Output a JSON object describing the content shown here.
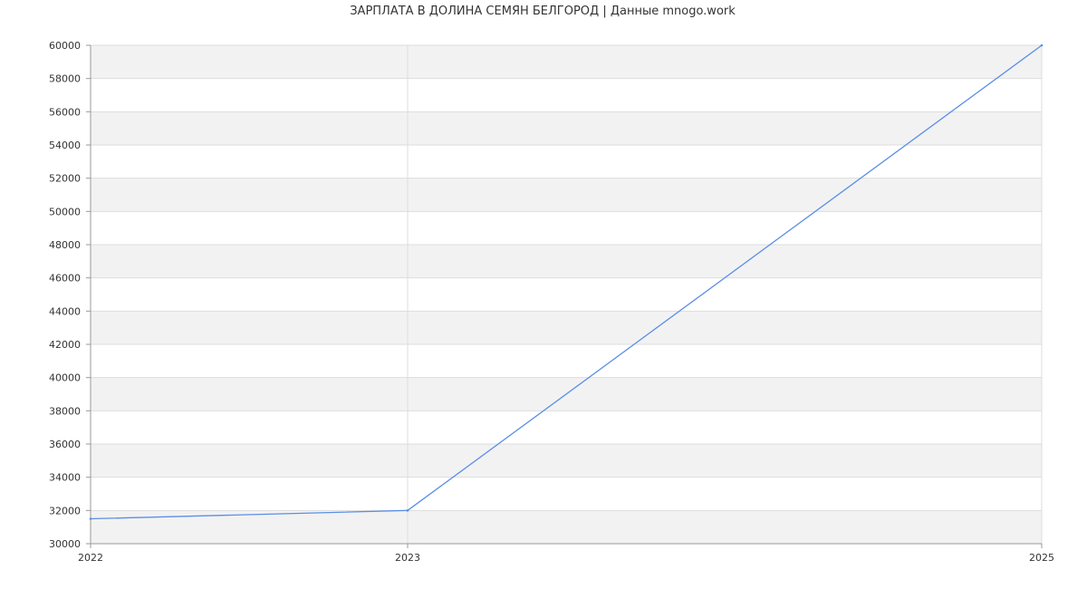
{
  "chart_data": {
    "type": "line",
    "title": "ЗАРПЛАТА В  ДОЛИНА СЕМЯН БЕЛГОРОД | Данные mnogo.work",
    "xlabel": "",
    "ylabel": "",
    "x": [
      2022,
      2023,
      2025
    ],
    "x_ticks": [
      "2022",
      "2023",
      "2025"
    ],
    "ylim": [
      30000,
      60000
    ],
    "y_ticks": [
      30000,
      32000,
      34000,
      36000,
      38000,
      40000,
      42000,
      44000,
      46000,
      48000,
      50000,
      52000,
      54000,
      56000,
      58000,
      60000
    ],
    "grid": true,
    "legend": "none",
    "series": [
      {
        "values": [
          31500,
          32000,
          60000
        ],
        "color": "#5b8fe6"
      }
    ],
    "colors": {
      "band": "#f2f2f2",
      "grid": "#dddddd",
      "axis": "#999999",
      "text": "#333333"
    }
  }
}
